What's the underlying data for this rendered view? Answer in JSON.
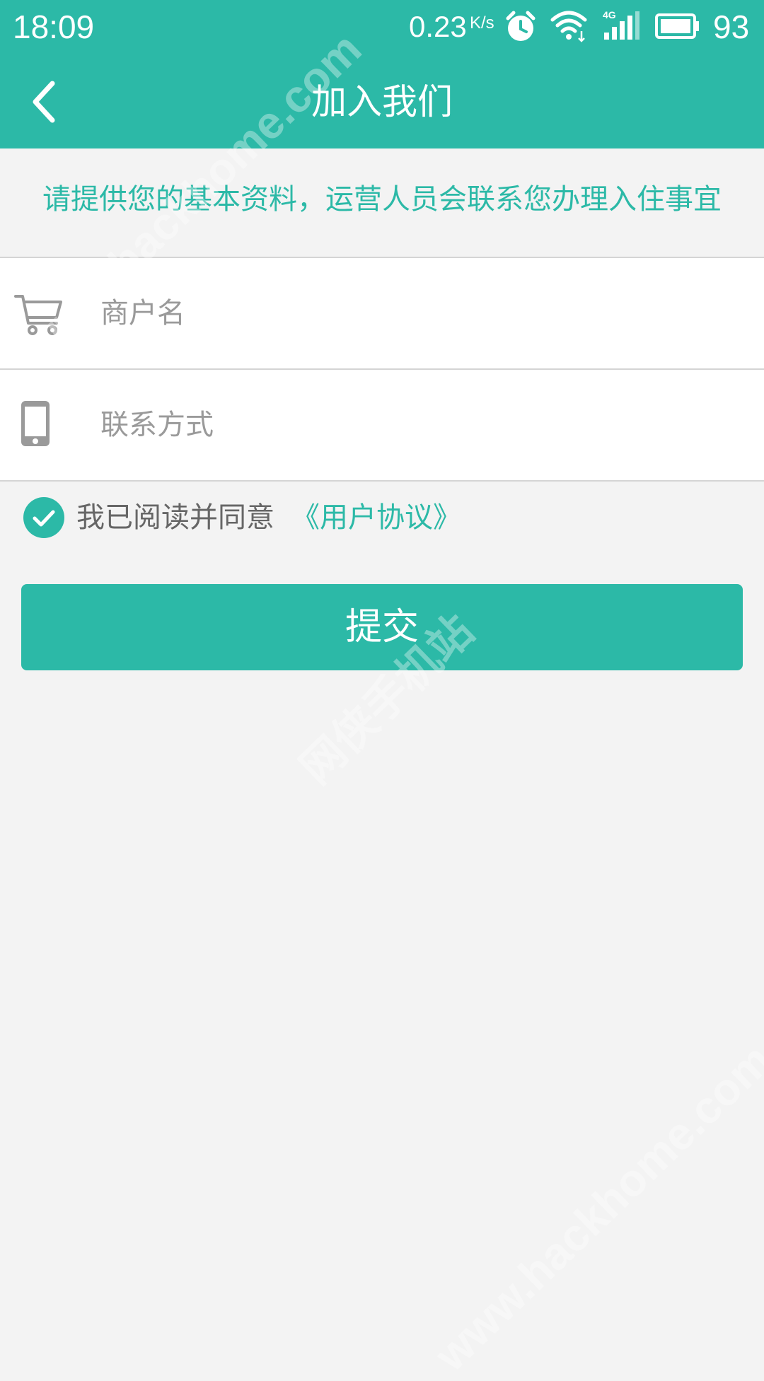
{
  "status_bar": {
    "time": "18:09",
    "net_speed": "0.23",
    "net_speed_unit": "K/s",
    "battery": "93",
    "icons": [
      "alarm-icon",
      "wifi-icon",
      "signal-4g-icon",
      "battery-icon"
    ]
  },
  "header": {
    "title": "加入我们",
    "back_icon": "chevron-left-icon"
  },
  "info": {
    "text": "请提供您的基本资料，运营人员会联系您办理入住事宜"
  },
  "form": {
    "merchant_name": {
      "placeholder": "商户名",
      "value": "",
      "icon": "cart-icon"
    },
    "contact": {
      "placeholder": "联系方式",
      "value": "",
      "icon": "phone-icon"
    }
  },
  "agreement": {
    "checked": true,
    "text": "我已阅读并同意",
    "link_text": "《用户协议》"
  },
  "submit": {
    "label": "提交"
  },
  "watermark": {
    "text_1": "www.hackhome.com",
    "text_2": "网侠手机站",
    "text_3": "www.hackhome.com"
  },
  "colors": {
    "accent": "#2cb9a7",
    "background": "#f3f3f3",
    "text_gray": "#666666",
    "placeholder_gray": "#9a9a9a"
  }
}
